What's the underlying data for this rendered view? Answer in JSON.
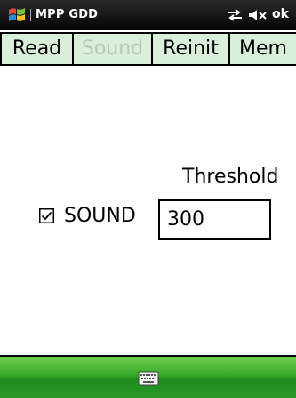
{
  "titlebar": {
    "title": "MPP GDD",
    "ok_label": "ok",
    "icons": [
      "windows-start-icon",
      "connectivity-icon",
      "volume-muted-icon"
    ]
  },
  "tabs": [
    {
      "label": "Read",
      "enabled": true
    },
    {
      "label": "Sound",
      "enabled": false
    },
    {
      "label": "Reinit",
      "enabled": true
    },
    {
      "label": "Mem",
      "enabled": true
    }
  ],
  "main": {
    "threshold_label": "Threshold",
    "sound_checkbox": {
      "label": "SOUND",
      "checked": true
    },
    "threshold_value": "300"
  },
  "bottombar": {
    "icon": "keyboard-icon"
  },
  "colors": {
    "tab_bg": "#d9efd9",
    "title_bg": "#050505",
    "softkey_bar": "#35a829"
  }
}
